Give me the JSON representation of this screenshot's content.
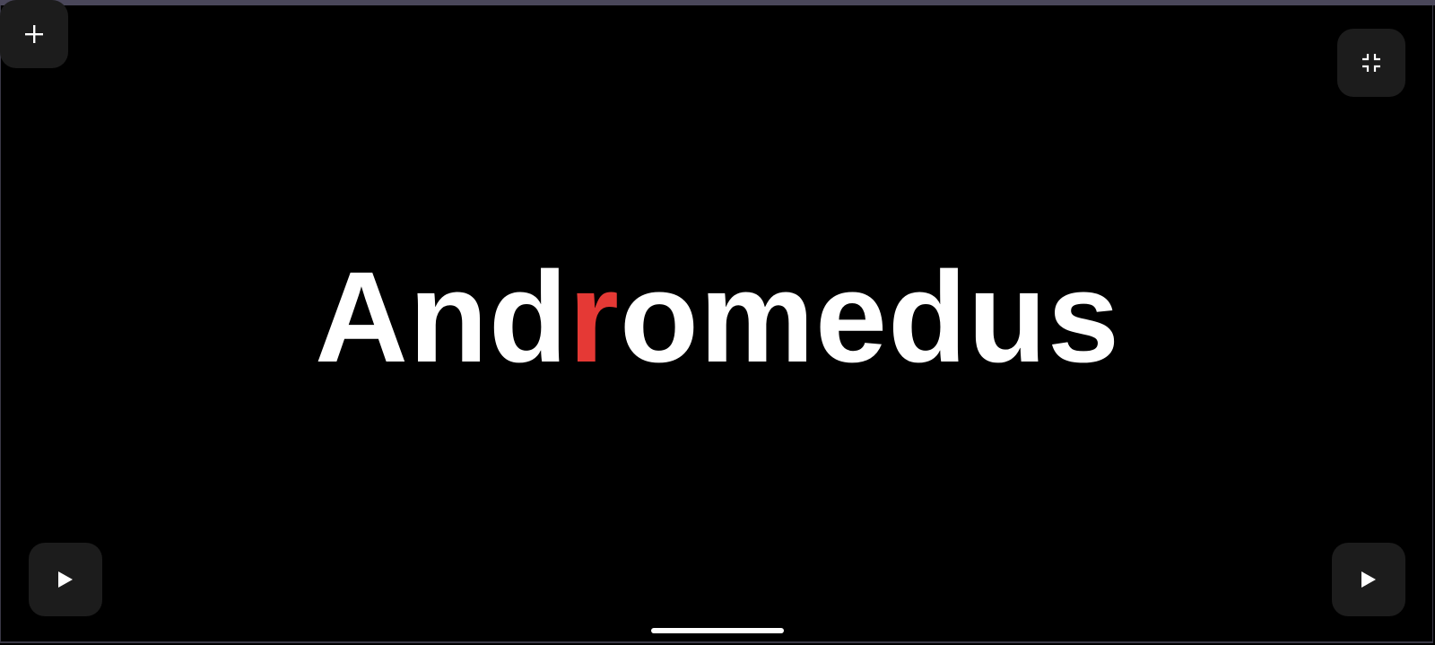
{
  "brand": {
    "before": "And",
    "accent": "r",
    "after": "omedus",
    "accent_color": "#e53935",
    "text_color": "#ffffff"
  },
  "controls": {
    "add_icon": "plus-icon",
    "exit_fullscreen_icon": "fullscreen-exit-icon",
    "play_icon": "play-icon"
  },
  "theme": {
    "background": "#000000",
    "button_background": "#1c1c1c"
  }
}
